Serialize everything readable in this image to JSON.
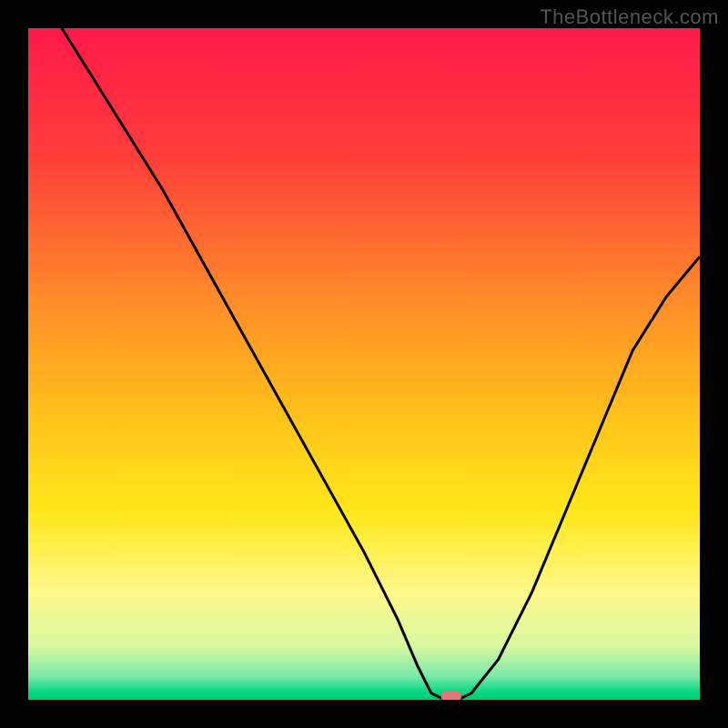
{
  "watermark": "TheBottleneck.com",
  "chart_data": {
    "type": "line",
    "title": "",
    "xlabel": "",
    "ylabel": "",
    "xlim": [
      0,
      100
    ],
    "ylim": [
      0,
      100
    ],
    "background": {
      "type": "vertical_gradient",
      "stops": [
        {
          "pos": 0.0,
          "color": "#ff1a4a"
        },
        {
          "pos": 0.18,
          "color": "#ff3a3a"
        },
        {
          "pos": 0.4,
          "color": "#ff8a2a"
        },
        {
          "pos": 0.58,
          "color": "#ffc21a"
        },
        {
          "pos": 0.72,
          "color": "#ffe81a"
        },
        {
          "pos": 0.84,
          "color": "#fff88a"
        },
        {
          "pos": 0.92,
          "color": "#d8f8a0"
        },
        {
          "pos": 0.965,
          "color": "#7ae8a8"
        },
        {
          "pos": 0.99,
          "color": "#00d880"
        },
        {
          "pos": 1.0,
          "color": "#00c870"
        }
      ]
    },
    "series": [
      {
        "name": "bottleneck-curve",
        "color": "#000000",
        "x": [
          5,
          10,
          15,
          20,
          25,
          30,
          35,
          40,
          45,
          50,
          55,
          58,
          60,
          62,
          64,
          66,
          70,
          75,
          80,
          85,
          90,
          95,
          100
        ],
        "y": [
          100,
          92,
          84,
          76,
          67,
          58,
          49,
          40,
          31,
          22,
          12,
          5,
          1,
          0,
          0,
          1,
          6,
          16,
          28,
          40,
          52,
          60,
          66
        ]
      }
    ],
    "marker": {
      "name": "optimal-point",
      "x": 63,
      "y": 0.5,
      "color": "#e07a7a",
      "shape": "rounded-rect"
    }
  }
}
